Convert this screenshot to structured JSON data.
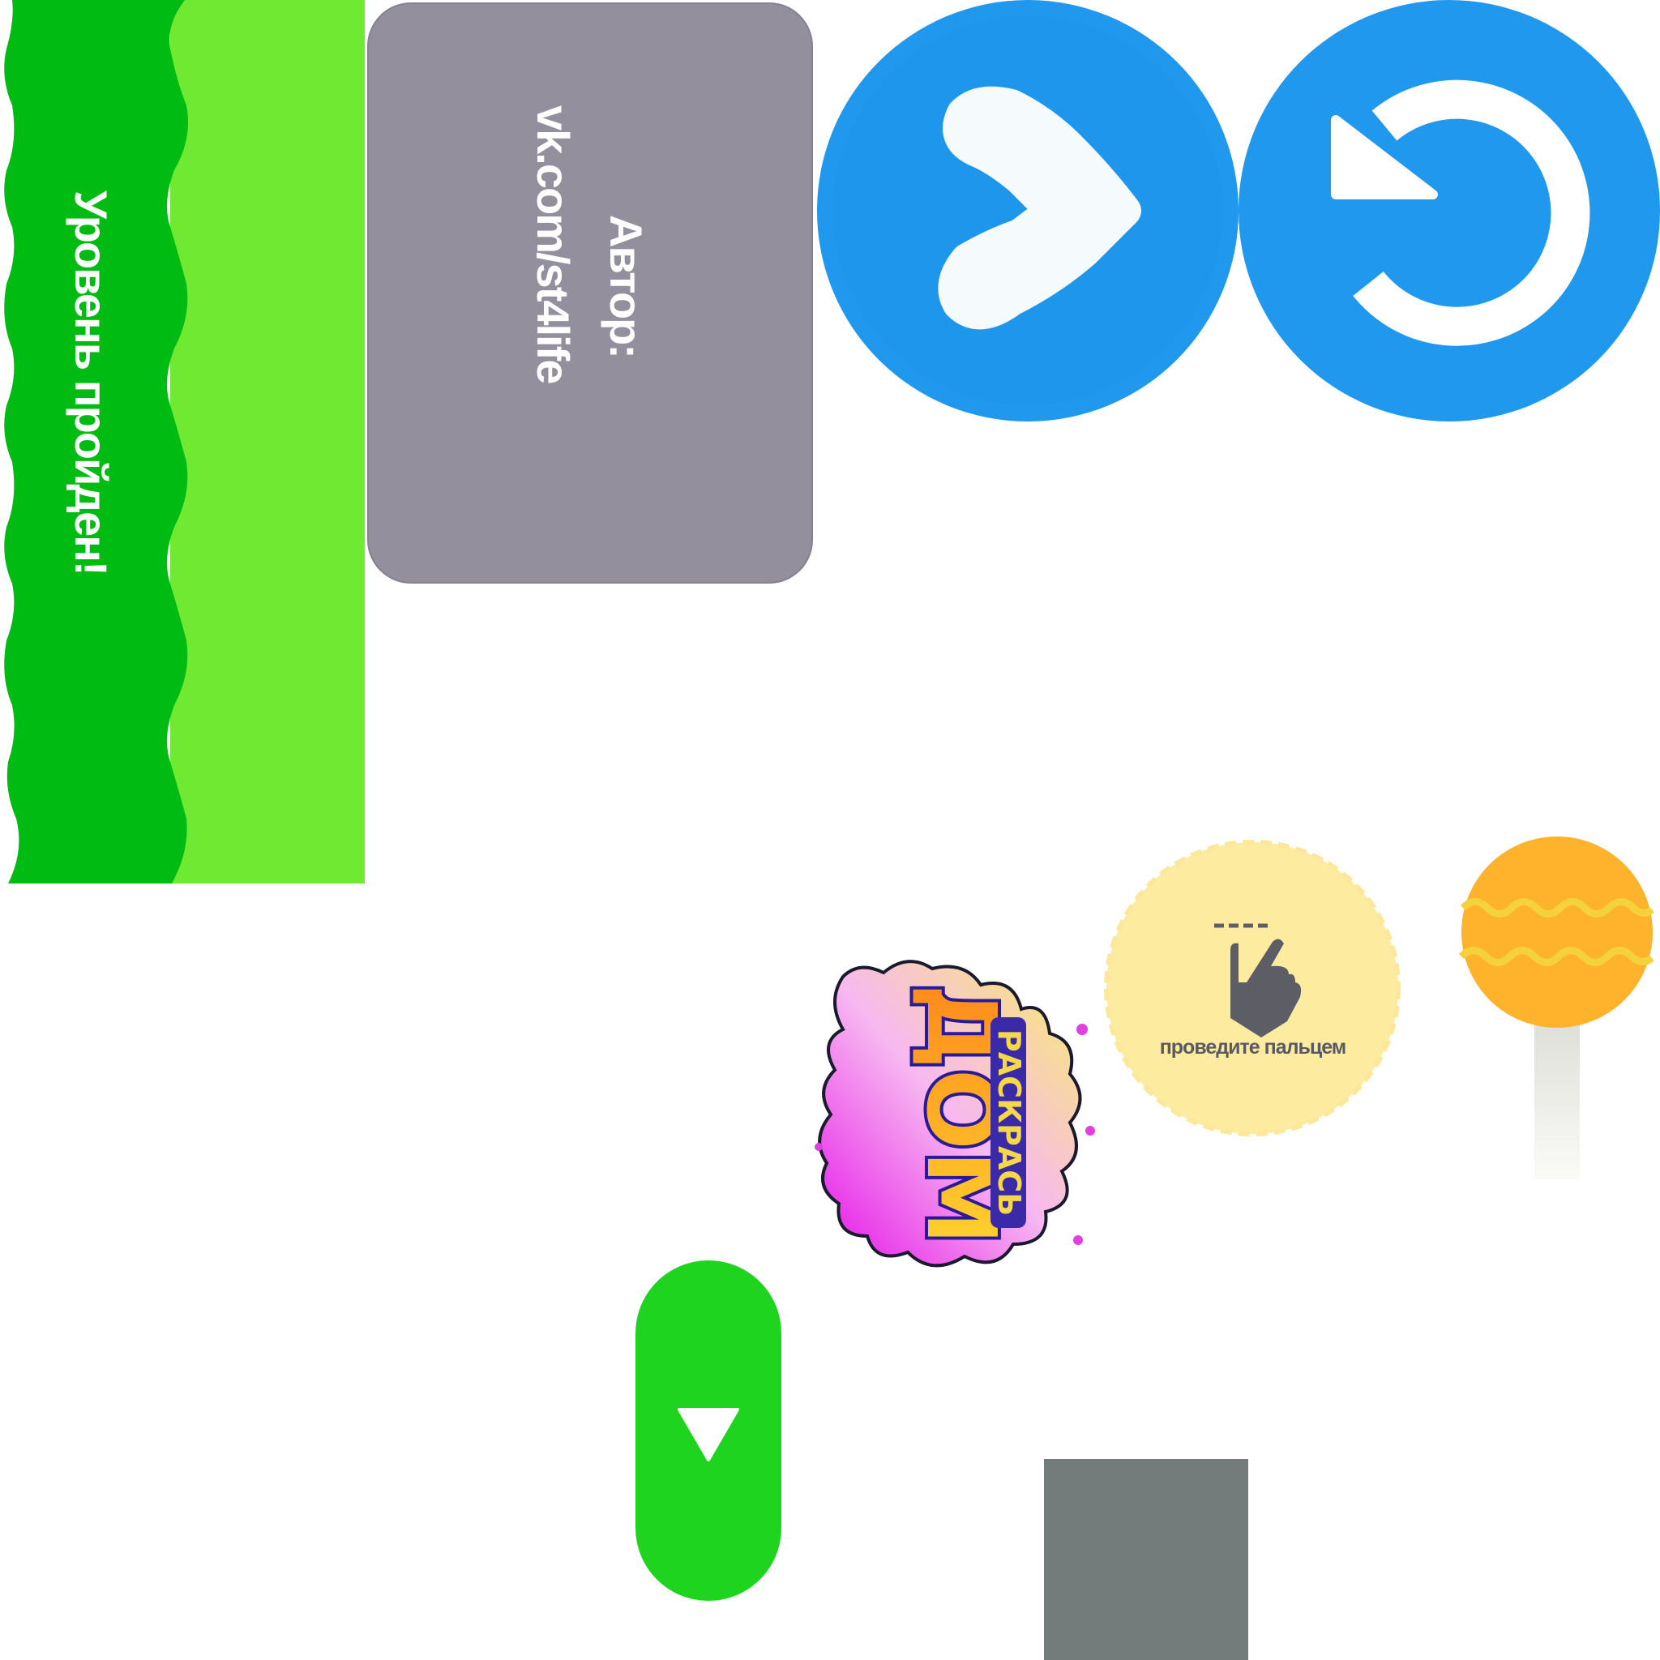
{
  "banner": {
    "text": "Уровень пройден!",
    "color_dark": "#00bc12",
    "color_light": "#6fe932"
  },
  "author": {
    "label": "Автор:",
    "link": "vk.com/st4life",
    "background": "#938f9d"
  },
  "buttons": {
    "next_icon": "chevron-right-icon",
    "restart_icon": "restart-icon",
    "color": "#1f98ee"
  },
  "logo": {
    "top_text": "РАСКРАСЬ",
    "main_text": "ДОМ"
  },
  "hint": {
    "text": "проведите пальцем",
    "icon": "swipe-hand-icon",
    "background": "#fdeca0"
  },
  "lollipop": {
    "color": "#ffb22c"
  },
  "down_button": {
    "icon": "triangle-down-icon",
    "color": "#1fd41f"
  },
  "block": {
    "color": "#737b7b"
  }
}
